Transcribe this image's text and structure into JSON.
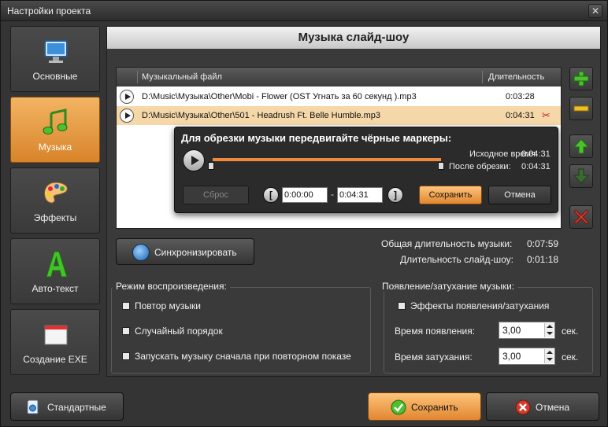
{
  "window": {
    "title": "Настройки проекта",
    "close_glyph": "✕"
  },
  "nav": {
    "items": [
      {
        "label": "Основные",
        "icon": "monitor-icon",
        "active": false
      },
      {
        "label": "Музыка",
        "icon": "music-note-icon",
        "active": true
      },
      {
        "label": "Эффекты",
        "icon": "palette-icon",
        "active": false
      },
      {
        "label": "Авто-текст",
        "icon": "letter-a-icon",
        "active": false
      },
      {
        "label": "Создание EXE",
        "icon": "window-icon",
        "active": false
      }
    ]
  },
  "panel": {
    "title": "Музыка слайд-шоу"
  },
  "table": {
    "col_file": "Музыкальный файл",
    "col_duration": "Длительность",
    "rows": [
      {
        "file": "D:\\Music\\Музыка\\Other\\Mobi - Flower (OST  Угнать за 60 секунд ).mp3",
        "duration": "0:03:28",
        "selected": false
      },
      {
        "file": "D:\\Music\\Музыка\\Other\\501 - Headrush Ft. Belle Humble.mp3",
        "duration": "0:04:31",
        "selected": true
      }
    ]
  },
  "trim": {
    "title": "Для обрезки музыки передвигайте чёрные маркеры:",
    "original_label": "Исходное время:",
    "original_value": "0:04:31",
    "after_label": "После обрезки:",
    "after_value": "0:04:31",
    "reset_label": "Сброс",
    "start_value": "0:00:00",
    "end_value": "0:04:31",
    "dash": "-",
    "bracket_left": "[",
    "bracket_right": "]",
    "save_label": "Сохранить",
    "cancel_label": "Отмена"
  },
  "sync": {
    "label": "Синхронизировать"
  },
  "stats": {
    "music_duration_label": "Общая длительность музыки:",
    "music_duration_value": "0:07:59",
    "slideshow_duration_label": "Длительность слайд-шоу:",
    "slideshow_duration_value": "0:01:18"
  },
  "playback": {
    "title": "Режим воспроизведения:",
    "options": [
      "Повтор музыки",
      "Случайный порядок",
      "Запускать музыку сначала при повторном показе"
    ]
  },
  "fade": {
    "title": "Появление/затухание музыки:",
    "effects_label": "Эффекты появления/затухания",
    "fade_in_label": "Время появления:",
    "fade_in_value": "3,00",
    "fade_out_label": "Время затухания:",
    "fade_out_value": "3,00",
    "unit": "сек."
  },
  "footer": {
    "defaults_label": "Стандартные",
    "save_label": "Сохранить",
    "cancel_label": "Отмена"
  },
  "colors": {
    "accent": "#e08630",
    "active_nav": "#f3b463",
    "add": "#3fa52e",
    "remove": "#d23b2b"
  }
}
